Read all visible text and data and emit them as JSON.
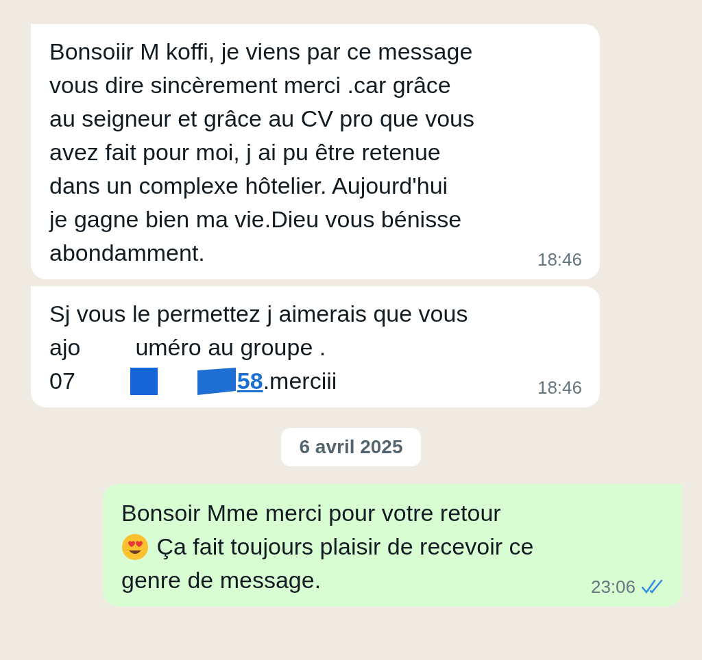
{
  "messages": [
    {
      "kind": "incoming",
      "lines": [
        [
          {
            "kind": "text",
            "text": "Bonsoiir M koffi, je viens par ce message"
          }
        ],
        [
          {
            "kind": "text",
            "text": "vous dire sincèrement merci .car grâce"
          }
        ],
        [
          {
            "kind": "text",
            "text": "au seigneur et grâce au CV pro que vous"
          }
        ],
        [
          {
            "kind": "text",
            "text": "avez fait pour moi, j ai pu être retenue"
          }
        ],
        [
          {
            "kind": "text",
            "text": "dans un complexe hôtelier. Aujourd'hui"
          }
        ],
        [
          {
            "kind": "text",
            "text": "je gagne bien ma vie.Dieu vous bénisse"
          }
        ],
        [
          {
            "kind": "text",
            "text": "abondamment."
          }
        ]
      ],
      "time": "18:46"
    },
    {
      "kind": "incoming",
      "lines": [
        [
          {
            "kind": "text",
            "text": "Sj vous le permettez j aimerais que vous"
          }
        ],
        [
          {
            "kind": "text",
            "text": "ajo"
          },
          {
            "kind": "redaction"
          },
          {
            "kind": "text",
            "text": "uméro au groupe ."
          }
        ],
        [
          {
            "kind": "text",
            "text": "07"
          },
          {
            "kind": "redaction"
          },
          {
            "kind": "link",
            "text": "58"
          },
          {
            "kind": "text",
            "text": ".merciii"
          }
        ]
      ],
      "time": "18:46"
    },
    {
      "kind": "date",
      "text": "6 avril 2025"
    },
    {
      "kind": "outgoing",
      "lines": [
        [
          {
            "kind": "text",
            "text": "Bonsoir Mme merci pour votre retour"
          }
        ],
        [
          {
            "kind": "emoji"
          },
          {
            "kind": "text",
            "text": " Ça fait toujours plaisir de recevoir ce"
          }
        ],
        [
          {
            "kind": "text",
            "text": "genre de message."
          }
        ]
      ],
      "time": "23:06",
      "read": true
    }
  ]
}
